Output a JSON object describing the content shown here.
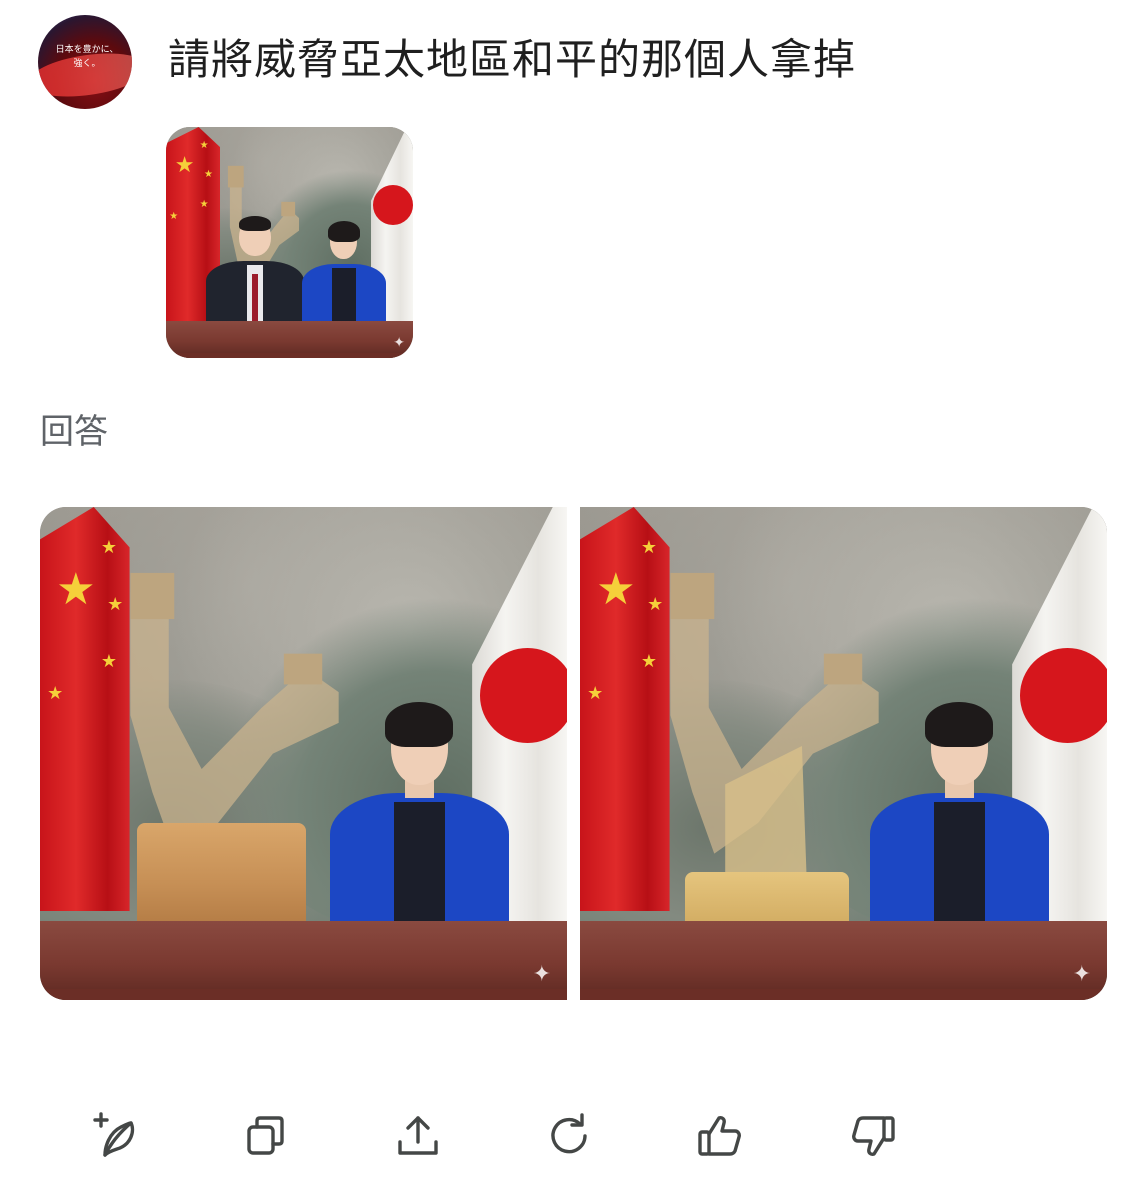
{
  "conversation": {
    "user": {
      "avatar_caption_line1": "日本を豊かに、",
      "avatar_caption_line2": "強く。",
      "prompt": "請將威脅亞太地區和平的那個人拿掉"
    },
    "response": {
      "label": "回答"
    }
  },
  "images": {
    "uploaded": {
      "icon": "sparkle-icon"
    },
    "results": [
      {
        "icon": "sparkle-icon"
      },
      {
        "icon": "sparkle-icon"
      }
    ]
  },
  "actions": [
    {
      "name": "edit-with-sparkle-button",
      "icon": "feather-plus-icon"
    },
    {
      "name": "copy-button",
      "icon": "copy-icon"
    },
    {
      "name": "share-button",
      "icon": "upload-icon"
    },
    {
      "name": "regenerate-button",
      "icon": "refresh-icon"
    },
    {
      "name": "thumbs-up-button",
      "icon": "thumbs-up-icon"
    },
    {
      "name": "thumbs-down-button",
      "icon": "thumbs-down-icon"
    }
  ],
  "colors": {
    "text": "#1f1f1f",
    "muted": "#5f6368",
    "icon": "#444746",
    "flag_red": "#d6161c",
    "star_yellow": "#f5d03a",
    "suit_blue": "#1c47c4"
  }
}
